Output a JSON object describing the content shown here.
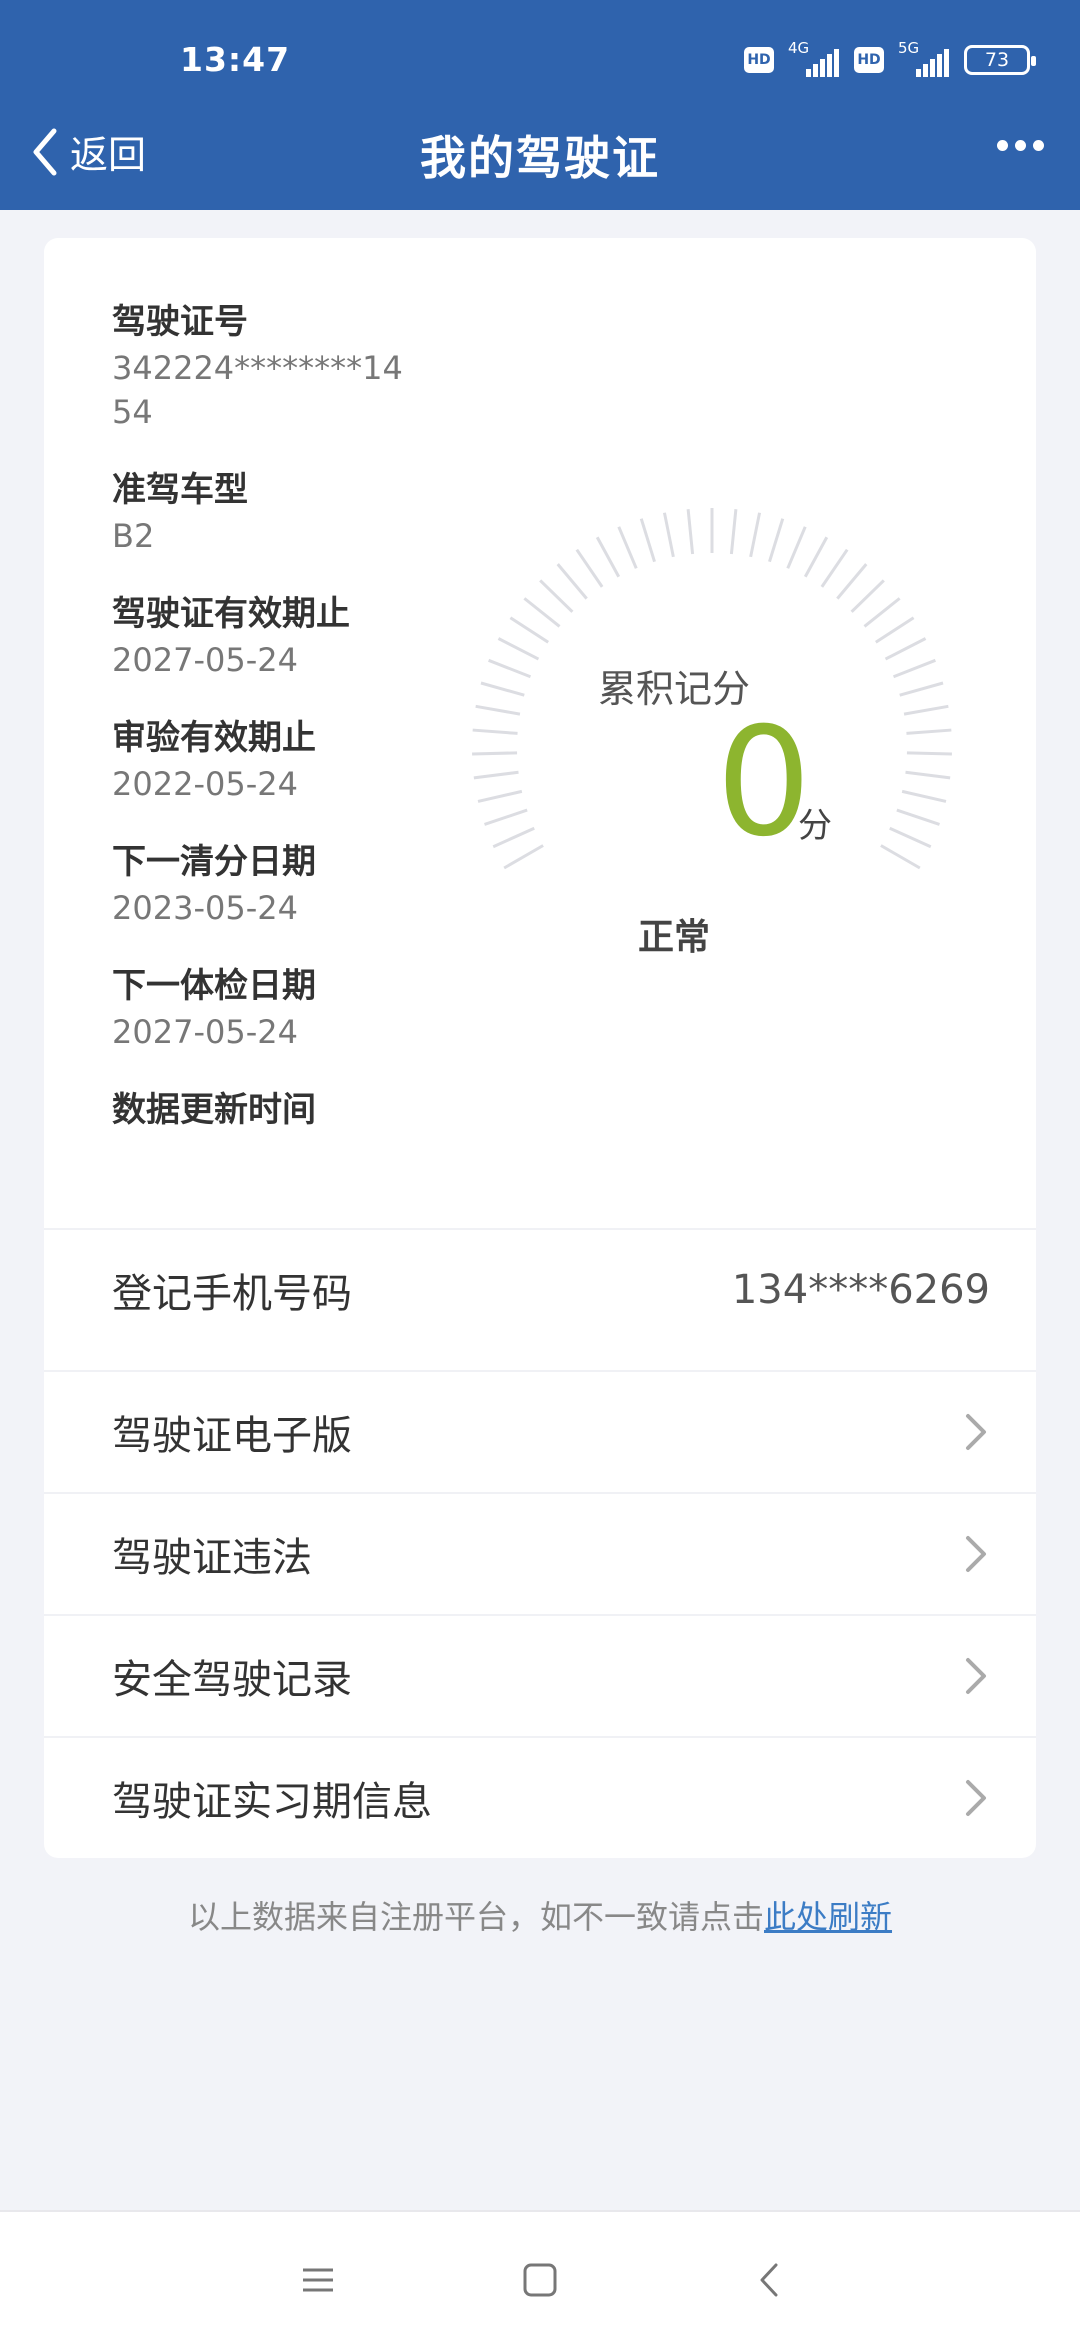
{
  "status_bar": {
    "time": "13:47",
    "hd1": "HD",
    "net1": "4G",
    "hd2": "HD",
    "net2": "5G",
    "battery": "73"
  },
  "header": {
    "back_label": "返回",
    "title": "我的驾驶证",
    "more_icon": "more-dots-icon"
  },
  "license": {
    "items": [
      {
        "label": "驾驶证号",
        "value": "342224********1454"
      },
      {
        "label": "准驾车型",
        "value": "B2"
      },
      {
        "label": "驾驶证有效期止",
        "value": "2027-05-24"
      },
      {
        "label": "审验有效期止",
        "value": "2022-05-24"
      },
      {
        "label": "下一清分日期",
        "value": "2023-05-24"
      },
      {
        "label": "下一体检日期",
        "value": "2027-05-24"
      },
      {
        "label": "数据更新时间",
        "value": ""
      }
    ]
  },
  "gauge": {
    "title": "累积记分",
    "score": "0",
    "unit": "分",
    "status": "正常",
    "score_color": "#8db52f"
  },
  "phone_row": {
    "label": "登记手机号码",
    "value": "134****6269"
  },
  "menu": [
    {
      "label": "驾驶证电子版"
    },
    {
      "label": "驾驶证违法"
    },
    {
      "label": "安全驾驶记录"
    },
    {
      "label": "驾驶证实习期信息"
    }
  ],
  "footnote": {
    "text": "以上数据来自注册平台，如不一致请点击",
    "link": "此处刷新"
  },
  "colors": {
    "header_bg": "#2f63ad",
    "link": "#3c7cc5"
  }
}
